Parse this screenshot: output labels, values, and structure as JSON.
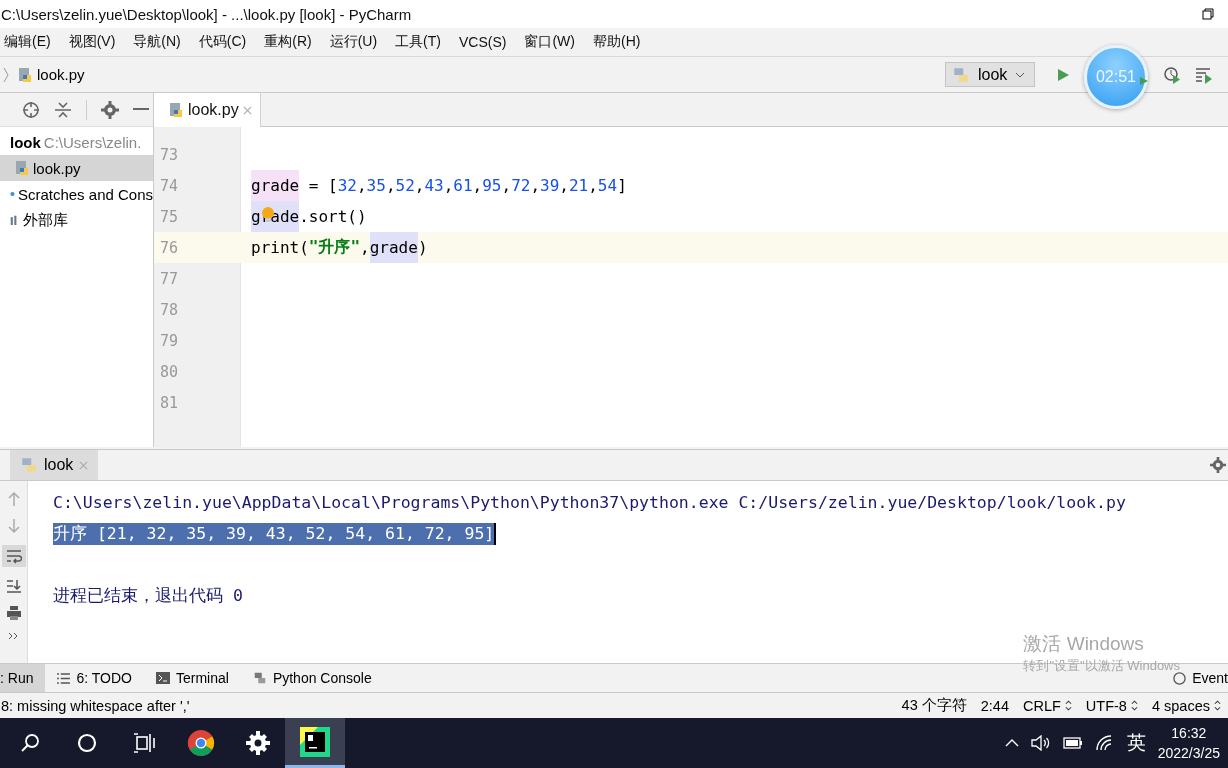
{
  "window": {
    "title": "C:\\Users\\zelin.yue\\Desktop\\look] - ...\\look.py [look] - PyCharm"
  },
  "menu": [
    "编辑(E)",
    "视图(V)",
    "导航(N)",
    "代码(C)",
    "重构(R)",
    "运行(U)",
    "工具(T)",
    "VCS(S)",
    "窗口(W)",
    "帮助(H)"
  ],
  "breadcrumb": "look.py",
  "run_config": "look",
  "timer": "02:51",
  "project_tree": [
    {
      "label": "look",
      "bold": true,
      "path": "C:\\Users\\zelin.",
      "expanded": true,
      "children": [
        {
          "label": "look.py",
          "selected": true
        }
      ],
      "selected": false
    },
    {
      "label": "Scratches and Cons",
      "selected": false
    },
    {
      "label": "外部库",
      "selected": false
    }
  ],
  "editor_tabs": [
    {
      "label": "look.py",
      "selected": true
    }
  ],
  "code_lines": [
    {
      "number": "73",
      "current": false
    },
    {
      "number": "74",
      "current": false,
      "tokens": [
        {
          "text": "grade",
          "kind": "def"
        },
        {
          "text": " = [",
          "kind": "plain"
        },
        {
          "text": "32",
          "kind": "num"
        },
        {
          "text": ",",
          "kind": "plain"
        },
        {
          "text": "35",
          "kind": "num"
        },
        {
          "text": ",",
          "kind": "plain"
        },
        {
          "text": "52",
          "kind": "num"
        },
        {
          "text": ",",
          "kind": "plain"
        },
        {
          "text": "43",
          "kind": "num"
        },
        {
          "text": ",",
          "kind": "plain"
        },
        {
          "text": "61",
          "kind": "num"
        },
        {
          "text": ",",
          "kind": "plain"
        },
        {
          "text": "95",
          "kind": "num"
        },
        {
          "text": ",",
          "kind": "plain"
        },
        {
          "text": "72",
          "kind": "num"
        },
        {
          "text": ",",
          "kind": "plain"
        },
        {
          "text": "39",
          "kind": "num"
        },
        {
          "text": ",",
          "kind": "plain"
        },
        {
          "text": "21",
          "kind": "num"
        },
        {
          "text": ",",
          "kind": "plain"
        },
        {
          "text": "54",
          "kind": "num"
        },
        {
          "text": "]",
          "kind": "plain"
        }
      ]
    },
    {
      "number": "75",
      "current": false,
      "bulb": true,
      "tokens": [
        {
          "text": "grade",
          "kind": "use"
        },
        {
          "text": ".sort()",
          "kind": "plain"
        }
      ]
    },
    {
      "number": "76",
      "current": true,
      "tokens": [
        {
          "text": "print(",
          "kind": "plain"
        },
        {
          "text": "\"升序\"",
          "kind": "str"
        },
        {
          "text": ",",
          "kind": "plain"
        },
        {
          "text": "grade",
          "kind": "use"
        },
        {
          "text": ")",
          "kind": "plain"
        }
      ]
    },
    {
      "number": "77",
      "current": false
    },
    {
      "number": "78",
      "current": false
    },
    {
      "number": "79",
      "current": false
    },
    {
      "number": "80",
      "current": false
    },
    {
      "number": "81",
      "current": false
    }
  ],
  "run_panel": {
    "tab": "look",
    "lines": [
      {
        "text": "C:\\Users\\zelin.yue\\AppData\\Local\\Programs\\Python\\Python37\\python.exe C:/Users/zelin.yue/Desktop/look/look.py",
        "selected": false
      },
      {
        "text": "升序 [21, 32, 35, 39, 43, 52, 54, 61, 72, 95]",
        "selected": true
      },
      {
        "text": "进程已结束，退出代码 0",
        "selected": false
      }
    ]
  },
  "tool_windows": [
    {
      "label": ": Run",
      "selected": true
    },
    {
      "label": "6: TODO",
      "selected": false
    },
    {
      "label": "Terminal",
      "selected": false
    },
    {
      "label": "Python Console",
      "selected": false
    }
  ],
  "watermark_title": "激活 Windows",
  "watermark_text": "转到\"设置\"以激活 Windows",
  "event_log": "Event",
  "status_bar": {
    "message": "8: missing whitespace after ','",
    "items": [
      {
        "text": "43 个字符",
        "menu": false
      },
      {
        "text": "2:44",
        "menu": false
      },
      {
        "text": "CRLF",
        "menu": true
      },
      {
        "text": "UTF-8",
        "menu": true
      },
      {
        "text": "4 spaces",
        "menu": true
      }
    ]
  },
  "taskbar": {
    "apps": [
      {
        "kind": "search",
        "active": false
      },
      {
        "kind": "cortana",
        "active": false
      },
      {
        "kind": "taskview",
        "active": false
      },
      {
        "kind": "chrome",
        "active": false
      },
      {
        "kind": "settings",
        "active": false
      },
      {
        "kind": "pycharm",
        "active": true
      }
    ],
    "ime": "英",
    "time": "16:32",
    "date": "2022/3/25"
  }
}
